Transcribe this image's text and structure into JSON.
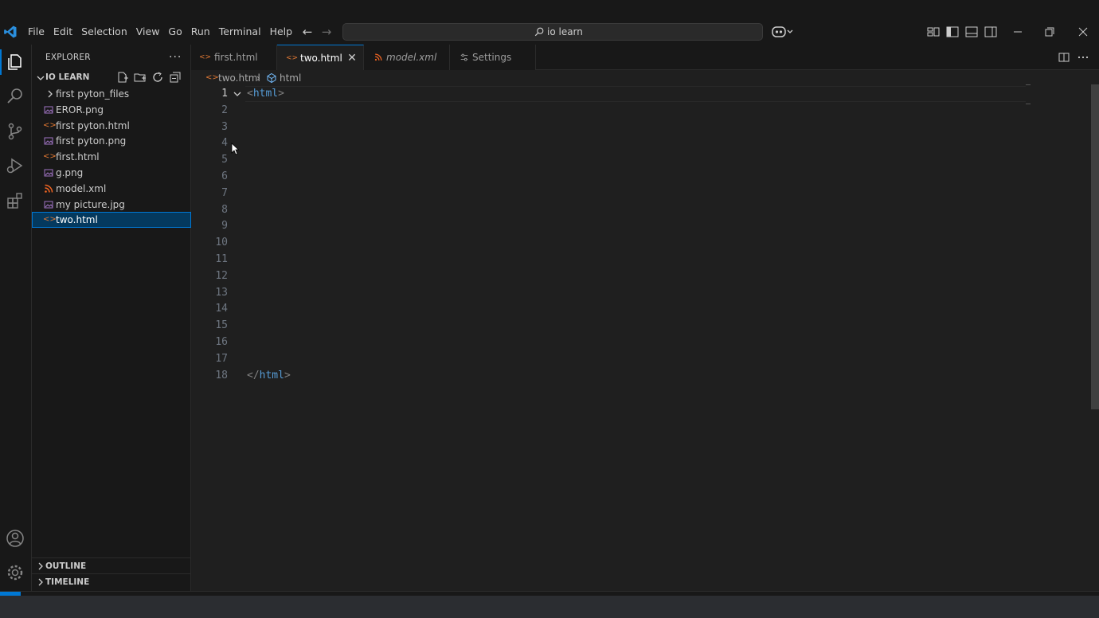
{
  "menu": [
    "File",
    "Edit",
    "Selection",
    "View",
    "Go",
    "Run",
    "Terminal",
    "Help"
  ],
  "search": {
    "text": "io learn"
  },
  "explorer": {
    "title": "EXPLORER",
    "folder": "IO LEARN",
    "files": [
      {
        "name": "first pyton_files",
        "type": "folder"
      },
      {
        "name": "EROR.png",
        "type": "image"
      },
      {
        "name": "first pyton.html",
        "type": "html"
      },
      {
        "name": "first pyton.png",
        "type": "image"
      },
      {
        "name": "first.html",
        "type": "html"
      },
      {
        "name": "g.png",
        "type": "image"
      },
      {
        "name": "model.xml",
        "type": "xml"
      },
      {
        "name": "my picture.jpg",
        "type": "image"
      },
      {
        "name": "two.html",
        "type": "html",
        "selected": true
      }
    ],
    "sections": {
      "outline": "OUTLINE",
      "timeline": "TIMELINE"
    }
  },
  "tabs": [
    {
      "label": "first.html",
      "type": "html",
      "active": false
    },
    {
      "label": "two.html",
      "type": "html",
      "active": true
    },
    {
      "label": "model.xml",
      "type": "xml",
      "active": false,
      "italic": true
    },
    {
      "label": "Settings",
      "type": "settings",
      "active": false
    }
  ],
  "breadcrumb": {
    "file": "two.html",
    "symbol": "html"
  },
  "editor": {
    "lines": [
      {
        "num": "1",
        "open": "<",
        "tag": "html",
        "close": ">"
      },
      {
        "num": "2"
      },
      {
        "num": "3"
      },
      {
        "num": "4"
      },
      {
        "num": "5"
      },
      {
        "num": "6"
      },
      {
        "num": "7"
      },
      {
        "num": "8"
      },
      {
        "num": "9"
      },
      {
        "num": "10"
      },
      {
        "num": "11"
      },
      {
        "num": "12"
      },
      {
        "num": "13"
      },
      {
        "num": "14"
      },
      {
        "num": "15"
      },
      {
        "num": "16"
      },
      {
        "num": "17"
      },
      {
        "num": "18",
        "open": "</",
        "tag": "html",
        "close": ">"
      }
    ]
  },
  "colors": {
    "accent": "#0078d4",
    "selection": "#04395e",
    "tag": "#569cd6",
    "html_icon": "#e37933",
    "image_icon": "#a074c4",
    "xml_icon": "#f26522"
  }
}
